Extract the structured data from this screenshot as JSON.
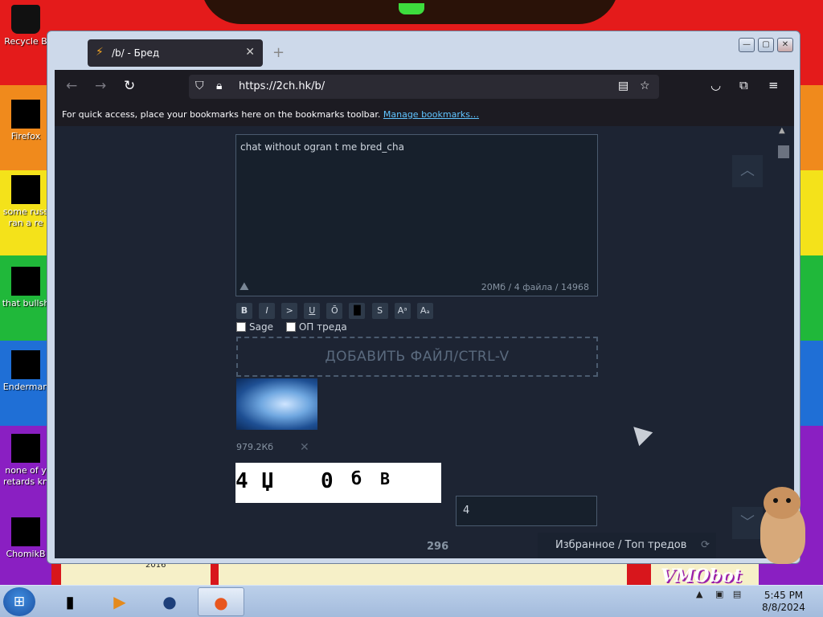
{
  "desktop": {
    "icons": [
      {
        "label": "Recycle B",
        "icon": "recycle-bin-icon"
      },
      {
        "label": "Firefox",
        "icon": "firefox-icon"
      },
      {
        "label": "some russ",
        "label2": "ran a re",
        "icon": "file-icon"
      },
      {
        "label": "that bullsh",
        "icon": "folder-icon"
      },
      {
        "label": "Enderman",
        "icon": "app-icon"
      },
      {
        "label": "none of y",
        "label2": "retards kn",
        "icon": "app-icon"
      },
      {
        "label": "ChomikB",
        "icon": "hamster-icon"
      }
    ],
    "wallpaper_text": "VMObot",
    "wallpaper_year": "2016"
  },
  "browser": {
    "tab_title": "/b/ - Бред",
    "url": "https://2ch.hk/b/",
    "bookmarks_hint": "For quick access, place your bookmarks here on the bookmarks toolbar.",
    "bookmarks_link": "Manage bookmarks…"
  },
  "page": {
    "message_text": "chat without ogran t me bred_cha",
    "message_stats": "20Мб / 4 файла / 14968",
    "format_buttons": [
      "B",
      "I",
      ">",
      "U",
      "Ō",
      "█",
      "S",
      "Aᵃ",
      "Aₐ"
    ],
    "sage_label": "Sage",
    "op_label": "ОП треда",
    "dropzone_label": "ДОБАВИТЬ ФАЙЛ/CTRL-V",
    "file_size": "979.2Кб",
    "captcha_chars": [
      "4",
      "Џ",
      "0",
      "б",
      "B"
    ],
    "captcha_input": "4",
    "counter": "296",
    "favorites_label": "Избранное / Топ тредов"
  },
  "taskbar": {
    "time": "5:45 PM",
    "date": "8/8/2024"
  }
}
